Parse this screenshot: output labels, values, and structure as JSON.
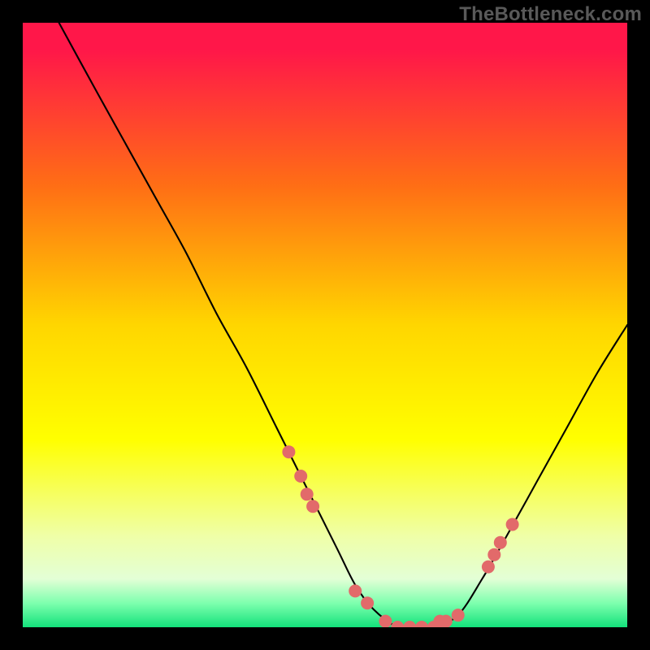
{
  "watermark": "TheBottleneck.com",
  "chart_data": {
    "type": "line",
    "title": "",
    "xlabel": "",
    "ylabel": "",
    "xlim": [
      0,
      100
    ],
    "ylim": [
      0,
      100
    ],
    "grid": false,
    "legend": false,
    "gradient_stops": [
      {
        "pct": 0,
        "color": "#ff1749"
      },
      {
        "pct": 4.5,
        "color": "#ff1749"
      },
      {
        "pct": 27,
        "color": "#ff6e15"
      },
      {
        "pct": 50,
        "color": "#ffd600"
      },
      {
        "pct": 69,
        "color": "#ffff00"
      },
      {
        "pct": 78,
        "color": "#f6ff61"
      },
      {
        "pct": 85,
        "color": "#efffa8"
      },
      {
        "pct": 92,
        "color": "#e3ffd6"
      },
      {
        "pct": 96,
        "color": "#7effae"
      },
      {
        "pct": 100,
        "color": "#13e27b"
      }
    ],
    "series": [
      {
        "name": "bottleneck-curve",
        "x": [
          6,
          12,
          17,
          22,
          27,
          32,
          37,
          42,
          47,
          52,
          55,
          58,
          62,
          65,
          68,
          72,
          76,
          80,
          85,
          90,
          95,
          100
        ],
        "y": [
          100,
          89,
          80,
          71,
          62,
          52,
          43,
          33,
          23,
          13,
          7,
          3,
          0,
          0,
          0,
          2,
          8,
          15,
          24,
          33,
          42,
          50
        ]
      }
    ],
    "markers": {
      "name": "highlight-dots",
      "color": "#e26a6a",
      "radius_px": 8,
      "points": [
        {
          "x": 44,
          "y": 29
        },
        {
          "x": 46,
          "y": 25
        },
        {
          "x": 47,
          "y": 22
        },
        {
          "x": 48,
          "y": 20
        },
        {
          "x": 55,
          "y": 6
        },
        {
          "x": 57,
          "y": 4
        },
        {
          "x": 60,
          "y": 1
        },
        {
          "x": 62,
          "y": 0
        },
        {
          "x": 64,
          "y": 0
        },
        {
          "x": 66,
          "y": 0
        },
        {
          "x": 68,
          "y": 0
        },
        {
          "x": 69,
          "y": 1
        },
        {
          "x": 70,
          "y": 1
        },
        {
          "x": 72,
          "y": 2
        },
        {
          "x": 77,
          "y": 10
        },
        {
          "x": 78,
          "y": 12
        },
        {
          "x": 79,
          "y": 14
        },
        {
          "x": 81,
          "y": 17
        }
      ]
    }
  }
}
